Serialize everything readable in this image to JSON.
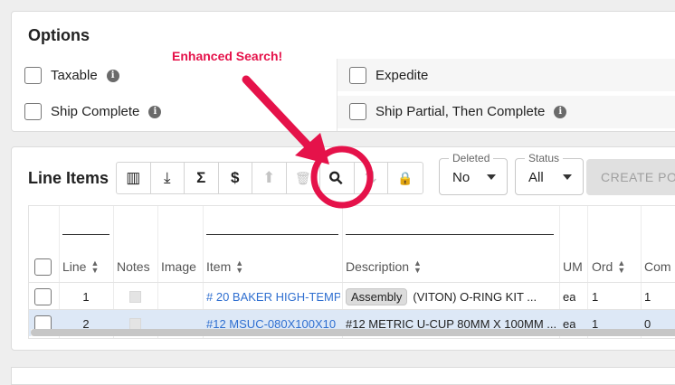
{
  "options": {
    "title": "Options",
    "items": [
      {
        "label": "Taxable",
        "checked": false,
        "info": true
      },
      {
        "label": "Expedite",
        "checked": false,
        "info": false
      },
      {
        "label": "Ship Complete",
        "checked": false,
        "info": true
      },
      {
        "label": "Ship Partial, Then Complete",
        "checked": false,
        "info": true
      }
    ]
  },
  "line_items": {
    "title": "Line Items",
    "toolbar": [
      {
        "icon": "columns-icon",
        "glyph": "▥",
        "enabled": true
      },
      {
        "icon": "download-icon",
        "glyph": "⤓",
        "enabled": true
      },
      {
        "icon": "sum-icon",
        "glyph": "Σ",
        "enabled": true
      },
      {
        "icon": "dollar-icon",
        "glyph": "$",
        "enabled": true
      },
      {
        "icon": "upload-icon",
        "glyph": "⬆",
        "enabled": false
      },
      {
        "icon": "trash-icon",
        "glyph": "🗑",
        "enabled": false
      },
      {
        "icon": "search-icon",
        "glyph": "⚲",
        "enabled": true
      },
      {
        "icon": "sort-icon",
        "glyph": "⇅",
        "enabled": false
      },
      {
        "icon": "lock-icon",
        "glyph": "🔒",
        "enabled": false
      }
    ],
    "deleted_filter": {
      "legend": "Deleted",
      "value": "No"
    },
    "status_filter": {
      "legend": "Status",
      "value": "All"
    },
    "create_po_label": "CREATE PO",
    "columns": [
      "Line",
      "Notes",
      "Image",
      "Item",
      "Description",
      "UM",
      "Ord",
      "Com"
    ],
    "rows": [
      {
        "line": "1",
        "item": "# 20 BAKER HIGH-TEMP",
        "tag": "Assembly",
        "description": "(VITON) O-RING KIT ...",
        "um": "ea",
        "ord": "1",
        "com": "1",
        "selected": false
      },
      {
        "line": "2",
        "item": "#12 MSUC-080X100X10",
        "tag": "",
        "description": "#12 METRIC U-CUP 80MM X 100MM ...",
        "um": "ea",
        "ord": "1",
        "com": "0",
        "selected": true
      }
    ]
  },
  "annotation": {
    "label": "Enhanced Search!",
    "color": "#e5124a"
  }
}
